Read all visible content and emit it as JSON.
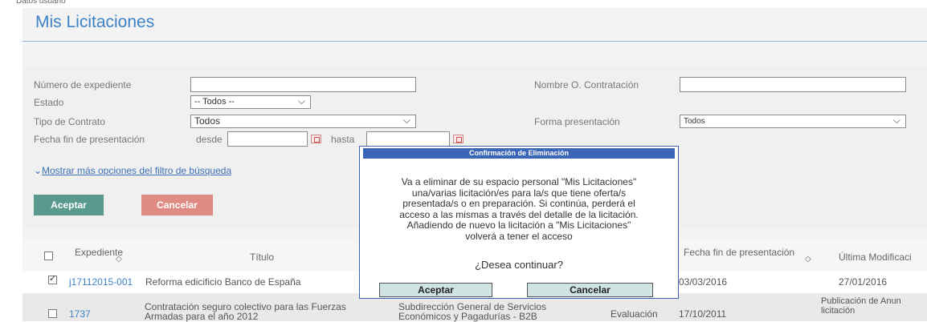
{
  "breadcrumb": "Datos usuario",
  "page_title": "Mis Licitaciones",
  "filters": {
    "expediente_label": "Número de expediente",
    "estado_label": "Estado",
    "estado_value": "-- Todos --",
    "tipo_label": "Tipo de Contrato",
    "tipo_value": "Todos",
    "fecha_label": "Fecha fin de presentación",
    "desde_label": "desde",
    "hasta_label": "hasta",
    "organo_label": "Nombre O. Contratación",
    "forma_label": "Forma presentación",
    "forma_value": "Todos",
    "more_options_link": "Mostrar más opciones del filtro de búsqueda"
  },
  "buttons": {
    "accept": "Aceptar",
    "cancel": "Cancelar"
  },
  "table": {
    "columns": [
      "Expediente",
      "Título",
      "Fecha fin de presentación",
      "Última Modificaci"
    ],
    "rows": [
      {
        "checked": true,
        "expediente": "j17112015-001",
        "titulo": "Reforma edicificio Banco de España",
        "fecha_fin": "03/03/2016",
        "ultima_mod": "27/01/2016"
      },
      {
        "checked": false,
        "expediente": "1737",
        "titulo_1": "Contratación seguro colectivo para las Fuerzas",
        "titulo_2": "Armadas para el año 2012",
        "organo_1": "Subdirección General de Servicios",
        "organo_2": "Económicos y Pagadurías - B2B",
        "estado": "Evaluación",
        "fecha_fin": "17/10/2011",
        "ultima_mod_1": "Publicación de Anun",
        "ultima_mod_2": "licitación"
      }
    ]
  },
  "dialog": {
    "title": "Confirmación de Eliminación",
    "lines": [
      "Va a eliminar de su espacio personal \"Mis Licitaciones\"",
      "una/varias licitación/es para la/s que tiene oferta/s",
      "presentada/s o en preparación. Si continúa, perderá el",
      "acceso a las mismas a través del detalle de la licitación.",
      "Añadiendo de nuevo la licitación a \"Mis Licitaciones\"",
      "volverá a tener el acceso"
    ],
    "question": "¿Desea continuar?",
    "accept": "Aceptar",
    "cancel": "Cancelar"
  },
  "colors": {
    "title": "#3d82c6",
    "accept": "#5a9a8e",
    "cancel": "#e08a84",
    "dialog_header": "#3b65b6"
  }
}
